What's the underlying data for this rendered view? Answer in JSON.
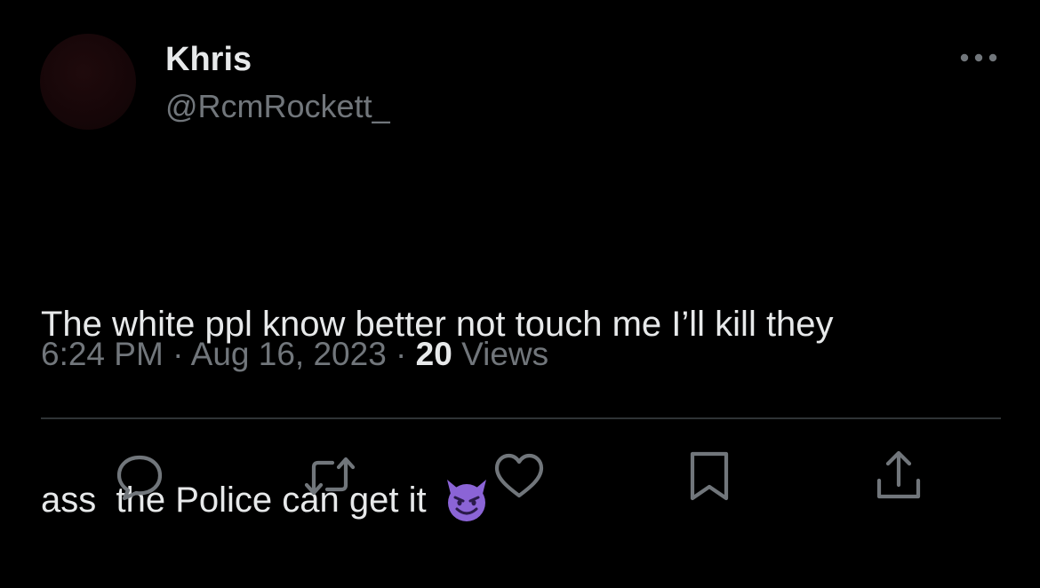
{
  "user": {
    "display_name": "Khris",
    "handle": "@RcmRockett_",
    "avatar_color": "#1a0709"
  },
  "tweet": {
    "line1": "The white ppl know better not touch me I’ll kill they",
    "line2": "ass  the Police can get it ",
    "emoji": "smiling-face-with-horns-icon"
  },
  "meta": {
    "time": "6:24 PM",
    "sep1": " · ",
    "date": "Aug 16, 2023",
    "sep2": " · ",
    "views_count": "20",
    "views_label": " Views"
  },
  "actions": [
    "reply-icon",
    "retweet-icon",
    "like-icon",
    "bookmark-icon",
    "share-icon"
  ],
  "colors": {
    "background": "#000000",
    "primary_text": "#e7e9ea",
    "secondary_text": "#71767b",
    "divider": "#2f3336",
    "emoji": "#8b64d6"
  }
}
